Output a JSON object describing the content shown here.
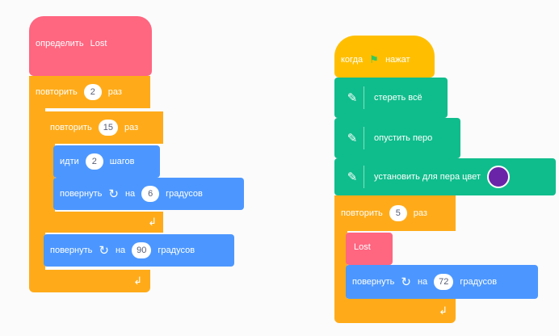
{
  "left_script": {
    "define_label": "определить",
    "define_name": "Lost",
    "repeat_outer_label": "повторить",
    "repeat_outer_value": "2",
    "repeat_outer_suffix": "раз",
    "repeat_inner_label": "повторить",
    "repeat_inner_value": "15",
    "repeat_inner_suffix": "раз",
    "move_label": "идти",
    "move_value": "2",
    "move_suffix": "шагов",
    "turn1_label": "повернуть",
    "turn1_on": "на",
    "turn1_value": "6",
    "turn1_suffix": "градусов",
    "turn2_label": "повернуть",
    "turn2_on": "на",
    "turn2_value": "90",
    "turn2_suffix": "градусов"
  },
  "right_script": {
    "flag_label_pre": "когда",
    "flag_label_post": "нажат",
    "erase_label": "стереть всё",
    "pen_down_label": "опустить перо",
    "set_color_label": "установить для пера цвет",
    "set_color_value": "#6a24a8",
    "repeat_label": "повторить",
    "repeat_value": "5",
    "repeat_suffix": "раз",
    "call_label": "Lost",
    "turn_label": "повернуть",
    "turn_on": "на",
    "turn_value": "72",
    "turn_suffix": "градусов"
  },
  "icons": {
    "rotate": "↻",
    "loop_arrow": "↲",
    "pen": "✎",
    "flag": "⚑"
  },
  "colors": {
    "control": "#ffab19",
    "custom": "#ff6680",
    "motion": "#4c97ff",
    "pen": "#0fbd8c",
    "events": "#ffbf00"
  }
}
